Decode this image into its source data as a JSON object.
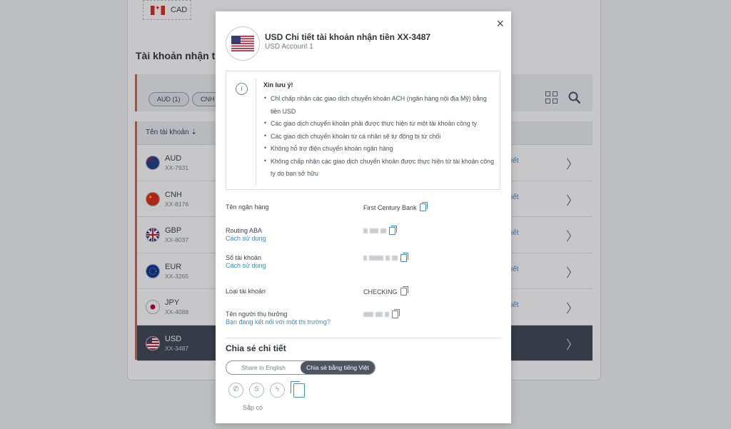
{
  "background": {
    "cad_label": "CAD",
    "section_title": "Tài khoản nhận tiền",
    "filters": [
      "AUD (1)",
      "CNH"
    ],
    "column_header": "Tên tài khoản ⇣",
    "link_fragment": "iết",
    "rows": [
      {
        "code": "AUD",
        "account": "XX-7931"
      },
      {
        "code": "CNH",
        "account": "XX-8176"
      },
      {
        "code": "GBP",
        "account": "XX-8037"
      },
      {
        "code": "EUR",
        "account": "XX-3265"
      },
      {
        "code": "JPY",
        "account": "XX-4088"
      },
      {
        "code": "USD",
        "account": "XX-3487"
      }
    ]
  },
  "modal": {
    "title": "USD Chi tiết tài khoản nhận tiền XX-3487",
    "subtitle": "USD Account 1",
    "close_label": "×",
    "notice": {
      "title": "Xin lưu ý!",
      "items": [
        "Chỉ chấp nhận các giao dịch chuyển khoản ACH (ngân hàng nội địa Mỹ) bằng tiền USD",
        "Các giao dịch chuyển khoản phải được thực hiện từ một tài khoản công ty",
        "Các giao dịch chuyển khoản từ cá nhân sẽ tự động bị từ chối",
        "Không hỗ trợ điện chuyển khoản ngân hàng",
        "Không chấp nhận các giao dịch chuyển khoản được thực hiện từ tài khoản công ty do bạn sở hữu"
      ]
    },
    "fields": {
      "bank_name_label": "Tên ngân hàng",
      "bank_name_value": "First Century Bank",
      "routing_label": "Routing ABA",
      "routing_help": "Cách sử dụng",
      "account_number_label": "Số tài khoản",
      "account_number_help": "Cách sử dụng",
      "account_type_label": "Loại tài khoản",
      "account_type_value": "CHECKING",
      "beneficiary_label": "Tên người thụ hưởng",
      "beneficiary_help": "Bạn đang kết nối với một thị trường?"
    },
    "share": {
      "title": "Chia sẻ chi tiết",
      "option_english": "Share in English",
      "option_vietnamese": "Chia sẻ bằng tiếng Việt",
      "selected": "vietnamese",
      "coming_soon": "Sắp có",
      "icons": [
        "whatsapp-icon",
        "skype-icon",
        "messenger-icon",
        "copy-document-icon"
      ]
    }
  }
}
